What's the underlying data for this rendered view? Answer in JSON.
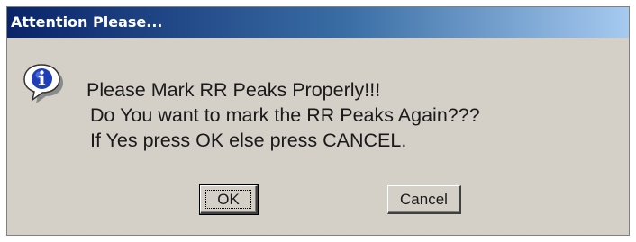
{
  "dialog": {
    "title": "Attention Please...",
    "icon": "info-icon",
    "message_lines": [
      "Please Mark RR Peaks Properly!!!",
      "Do You want to mark the RR Peaks Again???",
      "If Yes press OK else press CANCEL."
    ],
    "buttons": {
      "ok_label": "OK",
      "cancel_label": "Cancel"
    },
    "colors": {
      "titlebar_start": "#0a246a",
      "titlebar_end": "#a6caf0",
      "body": "#d4d0c8",
      "icon_blue": "#1f3fb8"
    }
  }
}
